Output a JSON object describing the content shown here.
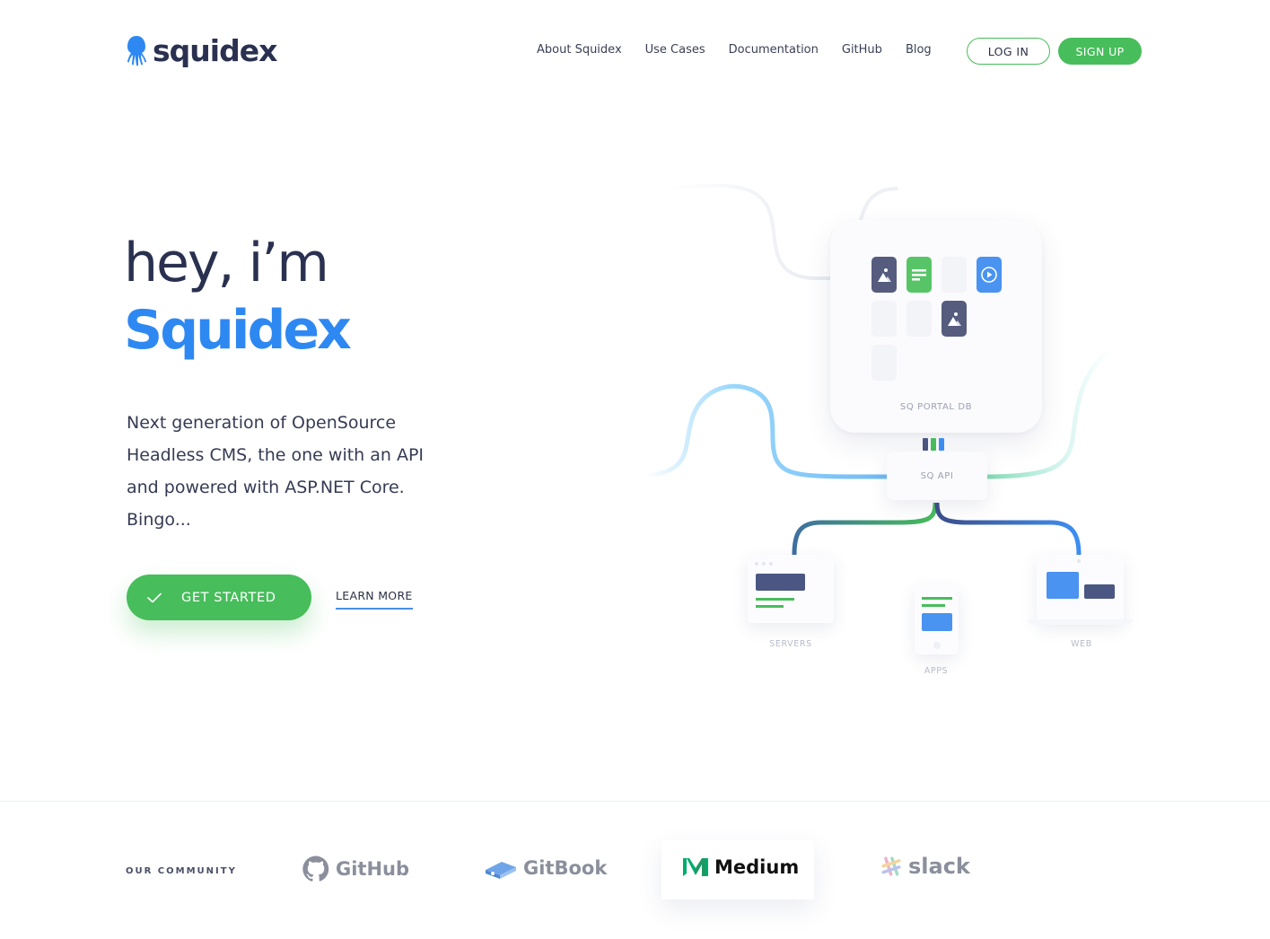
{
  "brand": {
    "logo_text": "squidex"
  },
  "nav": {
    "links": [
      "About Squidex",
      "Use Cases",
      "Documentation",
      "GitHub",
      "Blog"
    ],
    "login_label": "LOG IN",
    "signup_label": "SIGN UP"
  },
  "hero": {
    "greeting": "hey, i’m",
    "name": "Squidex",
    "description": "Next generation of OpenSource Headless CMS, the one with an API and powered with ASP.NET Core. Bingo...",
    "cta_primary": "GET STARTED",
    "cta_secondary": "LEARN MORE"
  },
  "illustration": {
    "db_label": "SQ PORTAL DB",
    "api_label": "SQ API",
    "servers_label": "SERVERS",
    "apps_label": "APPS",
    "web_label": "WEB"
  },
  "community": {
    "label": "OUR COMMUNITY",
    "brands": [
      "GitHub",
      "GitBook",
      "Medium",
      "slack"
    ]
  },
  "colors": {
    "accent_green": "#47bd5b",
    "accent_blue": "#2e88f2",
    "text_dark": "#2a3150"
  }
}
